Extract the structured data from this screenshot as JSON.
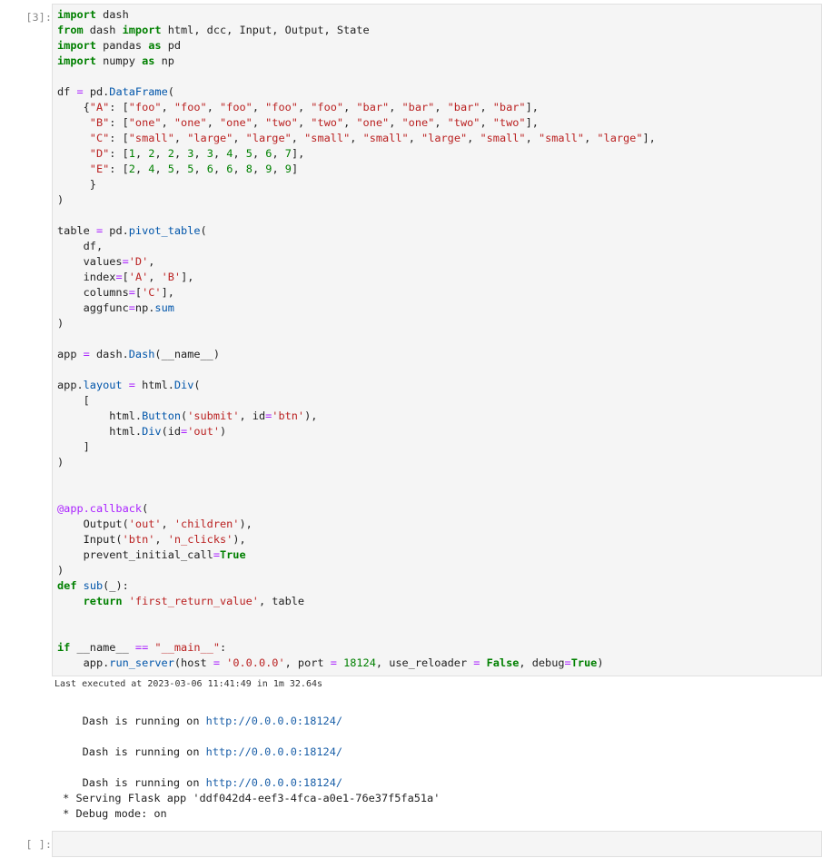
{
  "cell1": {
    "prompt": "[3]:",
    "exec_time": "Last executed at 2023-03-06 11:41:49 in 1m 32.64s"
  },
  "outputs": [
    {
      "text": "Dash is running on ",
      "url": "http://0.0.0.0:18124/"
    },
    {
      "text": "Dash is running on ",
      "url": "http://0.0.0.0:18124/"
    },
    {
      "text": "Dash is running on ",
      "url": "http://0.0.0.0:18124/"
    }
  ],
  "flask_lines": [
    " * Serving Flask app 'ddf042d4-eef3-4fca-a0e1-76e37f5fa51a'",
    " * Debug mode: on"
  ],
  "cell2": {
    "prompt": "[ ]:"
  },
  "colors": {
    "keyword": "#008000",
    "string": "#ba2121",
    "operator": "#aa22ff",
    "url": "#1a5fa8"
  }
}
